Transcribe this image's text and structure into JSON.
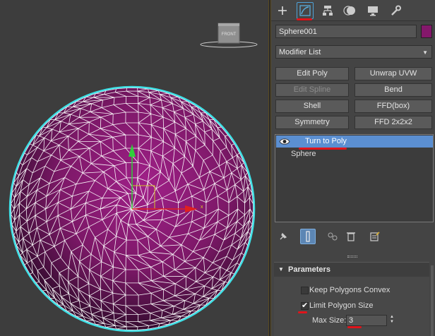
{
  "viewport": {
    "cube_label": "FRONT",
    "bg_color": "#3d3d3d",
    "sphere_color": "#8a1872",
    "selection_color": "#3fe0e6"
  },
  "command_panel": {
    "tabs": [
      {
        "icon": "plus-icon"
      },
      {
        "icon": "modify-icon",
        "active": true
      },
      {
        "icon": "hierarchy-icon"
      },
      {
        "icon": "motion-icon"
      },
      {
        "icon": "display-icon"
      },
      {
        "icon": "utilities-wrench-icon"
      }
    ],
    "object_name": "Sphere001",
    "object_color": "#84186b",
    "modifier_list_label": "Modifier List",
    "modifier_buttons": [
      {
        "label": "Edit Poly",
        "enabled": true
      },
      {
        "label": "Unwrap UVW",
        "enabled": true
      },
      {
        "label": "Edit Spline",
        "enabled": false
      },
      {
        "label": "Bend",
        "enabled": true
      },
      {
        "label": "Shell",
        "enabled": true
      },
      {
        "label": "FFD(box)",
        "enabled": true
      },
      {
        "label": "Symmetry",
        "enabled": true
      },
      {
        "label": "FFD 2x2x2",
        "enabled": true
      }
    ],
    "stack": [
      {
        "label": "Turn to Poly",
        "selected": true
      },
      {
        "label": "Sphere",
        "selected": false
      }
    ],
    "stack_tools": [
      "pin-stack-icon",
      "show-end-result-icon",
      "make-unique-icon",
      "remove-modifier-icon",
      "configure-modifier-sets-icon"
    ]
  },
  "parameters": {
    "title": "Parameters",
    "keep_polygons_convex": {
      "label": "Keep Polygons Convex",
      "checked": false
    },
    "limit_polygon_size": {
      "label": "Limit Polygon Size",
      "checked": true
    },
    "max_size": {
      "label": "Max Size:",
      "value": "3"
    }
  }
}
